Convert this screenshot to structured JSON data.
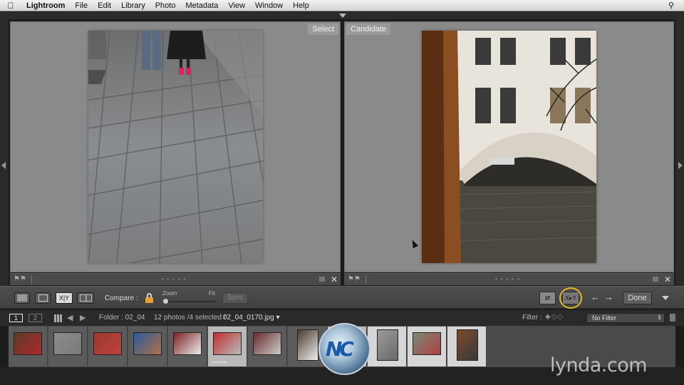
{
  "menubar": {
    "app_name": "Lightroom",
    "items": [
      "File",
      "Edit",
      "Library",
      "Photo",
      "Metadata",
      "View",
      "Window",
      "Help"
    ],
    "apple_icon": "apple-icon",
    "search_icon": "spotlight-icon"
  },
  "compare": {
    "select_label": "Select",
    "candidate_label": "Candidate"
  },
  "toolbar": {
    "compare_label": "Compare :",
    "zoom_label": "Zoom",
    "fit_label": "Fit",
    "zoom_level": 0,
    "sync_label": "Sync",
    "compare_view_label": "X|Y",
    "done_label": "Done",
    "prev_arrow": "←",
    "next_arrow": "→"
  },
  "filmstrip_bar": {
    "screen_1": "1",
    "screen_2": "2",
    "folder": "Folder : 02_04",
    "count": "12 photos /4 selected /",
    "filename": "02_04_0170.jpg ▾",
    "filter_label": "Filter :",
    "filter_value": "No Filter"
  },
  "thumbnails": [
    {
      "state": "normal",
      "colors": [
        "#5a3a2a",
        "#b02a2a"
      ],
      "tall": false
    },
    {
      "state": "normal",
      "colors": [
        "#8c8c8c",
        "#7a7a7a"
      ],
      "tall": false
    },
    {
      "state": "normal",
      "colors": [
        "#9a3a2a",
        "#c04040"
      ],
      "tall": false
    },
    {
      "state": "normal",
      "colors": [
        "#2a5a9a",
        "#b0704a"
      ],
      "tall": false
    },
    {
      "state": "normal",
      "colors": [
        "#7a2020",
        "#eeeeee"
      ],
      "tall": false
    },
    {
      "state": "sel",
      "colors": [
        "#c03030",
        "#bbbbbb"
      ],
      "tall": false,
      "stars": "★★★★★"
    },
    {
      "state": "normal",
      "colors": [
        "#6a2a2a",
        "#cccccc"
      ],
      "tall": false
    },
    {
      "state": "normal",
      "colors": [
        "#4a3a30",
        "#eeeeee"
      ],
      "tall": true
    },
    {
      "state": "sel",
      "colors": [
        "#6a6a6a",
        "#8a6a4a"
      ],
      "tall": true
    },
    {
      "state": "sel-light",
      "colors": [
        "#9a9a9a",
        "#6a6a6a"
      ],
      "tall": true
    },
    {
      "state": "sel-light",
      "colors": [
        "#7a8a7a",
        "#b04040"
      ],
      "tall": false
    },
    {
      "state": "sel-light",
      "colors": [
        "#7a4a2a",
        "#3a3a3a"
      ],
      "tall": true
    }
  ],
  "watermarks": {
    "nc_text": "NC",
    "lynda": "lynda.com"
  }
}
